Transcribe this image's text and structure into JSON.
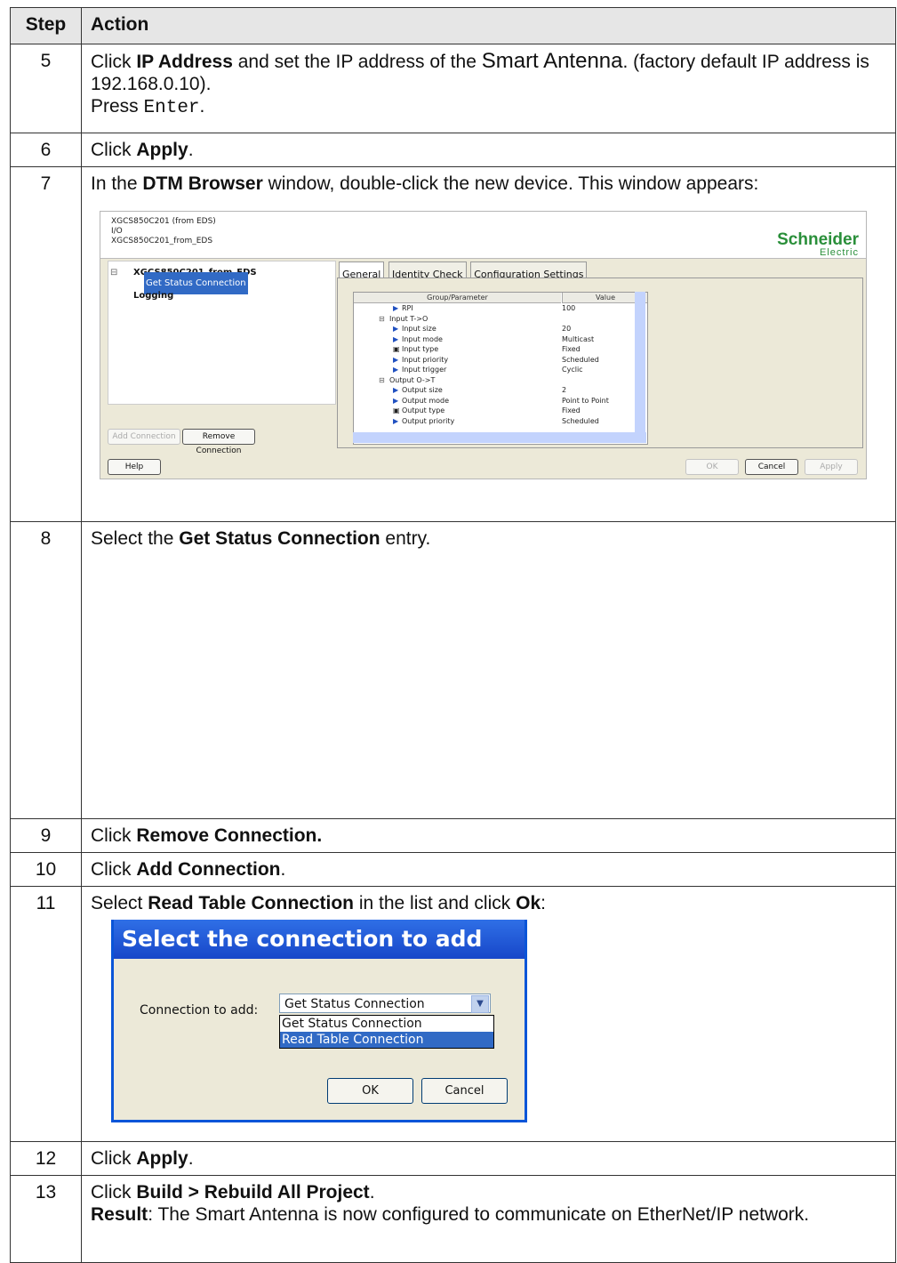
{
  "header": {
    "step": "Step",
    "action": "Action"
  },
  "rows": {
    "r5": {
      "num": "5",
      "t1": "Click ",
      "b1": "IP Address",
      "t2": " and set the IP address of the ",
      "big": "Smart Antenna",
      "t3": ". (factory default IP address is 192.168.0.10).",
      "t4": "Press ",
      "mono": "Enter",
      "t5": "."
    },
    "r6": {
      "num": "6",
      "t1": "Click ",
      "b1": "Apply",
      "t2": "."
    },
    "r7": {
      "num": "7",
      "t1": "In the ",
      "b1": "DTM Browser",
      "t2": " window, double-click the new device. This window appears:"
    },
    "r8": {
      "num": "8",
      "t1": "Select the ",
      "b1": "Get Status Connection",
      "t2": " entry."
    },
    "r9": {
      "num": "9",
      "t1": "Click ",
      "b1": "Remove Connection."
    },
    "r10": {
      "num": "10",
      "t1": "Click ",
      "b1": "Add Connection",
      "t2": "."
    },
    "r11": {
      "num": "11",
      "t1": "Select ",
      "b1": "Read Table Connection",
      "t2": " in the list and click ",
      "b2": "Ok",
      "t3": ":"
    },
    "r12": {
      "num": "12",
      "t1": "Click ",
      "b1": "Apply",
      "t2": "."
    },
    "r13": {
      "num": "13",
      "t1": "Click ",
      "b1": "Build > Rebuild All Project",
      "t2": ".",
      "b2": "Result",
      "t3": ": The Smart Antenna is now configured to communicate on EtherNet/IP network."
    }
  },
  "dtm": {
    "head": [
      "XGCS850C201 (from EDS)",
      "I/O",
      "XGCS850C201_from_EDS"
    ],
    "logo1": "Schneider",
    "logo2": "Electric",
    "tree_root": "XGCS850C201_from_EDS",
    "tree_sel": "Get Status Connection",
    "tree_log": "Logging",
    "tabs": [
      "General",
      "Identity Check",
      "Configuration Settings"
    ],
    "grid_hdr_param": "Group/Parameter",
    "grid_hdr_value": "Value",
    "grid": [
      {
        "p": "RPI",
        "v": "100"
      },
      {
        "p": "Input T->O",
        "v": ""
      },
      {
        "p": "Input size",
        "v": "20"
      },
      {
        "p": "Input mode",
        "v": "Multicast"
      },
      {
        "p": "Input type",
        "v": "Fixed"
      },
      {
        "p": "Input priority",
        "v": "Scheduled"
      },
      {
        "p": "Input trigger",
        "v": "Cyclic"
      },
      {
        "p": "Output O->T",
        "v": ""
      },
      {
        "p": "Output size",
        "v": "2"
      },
      {
        "p": "Output mode",
        "v": "Point to Point"
      },
      {
        "p": "Output type",
        "v": "Fixed"
      },
      {
        "p": "Output priority",
        "v": "Scheduled"
      }
    ],
    "add_conn": "Add Connection",
    "remove_conn": "Remove Connection",
    "help": "Help",
    "ok": "OK",
    "cancel": "Cancel",
    "apply": "Apply"
  },
  "dialog": {
    "title": "Select the connection to add",
    "label": "Connection to add:",
    "selected": "Get Status Connection",
    "options": [
      "Get Status Connection",
      "Read Table Connection"
    ],
    "ok": "OK",
    "cancel": "Cancel"
  }
}
